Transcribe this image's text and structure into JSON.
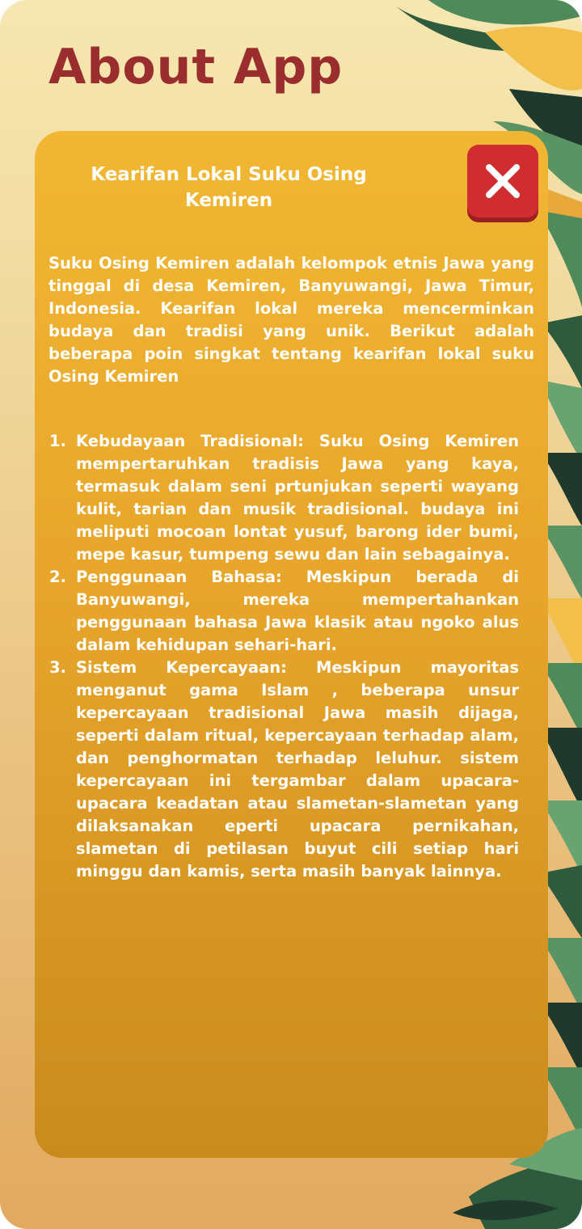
{
  "header": {
    "title": "About App"
  },
  "card": {
    "title": "Kearifan Lokal Suku Osing Kemiren",
    "close_icon": "close-x-icon",
    "intro": "Suku Osing Kemiren adalah kelompok etnis Jawa yang tinggal di desa Kemiren, Banyuwangi, Jawa Timur, Indonesia. Kearifan lokal mereka mencerminkan budaya dan tradisi yang unik. Berikut adalah beberapa poin singkat tentang kearifan lokal suku Osing Kemiren",
    "points": [
      {
        "number": "1.",
        "text": "Kebudayaan Tradisional: Suku Osing Kemiren mempertaruhkan tradisis Jawa yang kaya, termasuk dalam seni prtunjukan seperti wayang kulit, tarian dan musik tradisional. budaya ini meliputi mocoan lontat yusuf, barong ider bumi, mepe kasur, tumpeng sewu dan lain sebagainya."
      },
      {
        "number": "2.",
        "text": "Penggunaan Bahasa: Meskipun berada di Banyuwangi, mereka mempertahankan penggunaan bahasa Jawa klasik atau ngoko alus dalam kehidupan sehari-hari."
      },
      {
        "number": "3.",
        "text": "Sistem Kepercayaan: Meskipun mayoritas menganut gama Islam , beberapa unsur kepercayaan tradisional Jawa masih dijaga, seperti dalam ritual, kepercayaan terhadap alam, dan penghormatan terhadap leluhur. sistem kepercayaan ini tergambar dalam upacara-upacara keadatan atau slametan-slametan yang dilaksanakan eperti upacara pernikahan, slametan di petilasan buyut cili setiap hari minggu  dan kamis, serta masih banyak lainnya."
      }
    ]
  },
  "colors": {
    "title": "#9a2d2e",
    "card_top": "#f1b733",
    "card_bottom": "#c98b1d",
    "close_button": "#cf2d2f",
    "leaf_green": "#4f8a5b",
    "leaf_dark": "#1f3a2c"
  },
  "decor": {
    "leaves_icon": "tropical-leaves-decoration"
  }
}
